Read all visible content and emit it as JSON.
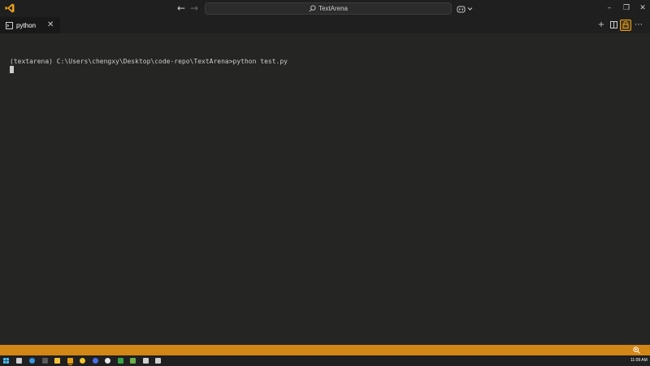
{
  "titlebar": {
    "search_text": "TextArena",
    "back_icon": "arrow-left-icon",
    "forward_icon": "arrow-right-icon",
    "minimize_glyph": "–",
    "restore_glyph": "❐",
    "close_glyph": "✕"
  },
  "tabs": [
    {
      "label": "python",
      "icon": "terminal-icon",
      "active": true
    }
  ],
  "tab_actions": {
    "new_terminal": "+",
    "more": "⋯"
  },
  "terminal": {
    "prompt_line": "(textarena) C:\\Users\\chengxy\\Desktop\\code-repo\\TextArena>python test.py"
  },
  "taskbar": {
    "clock": "11:09 AM"
  },
  "colors": {
    "status_bar": "#d18616",
    "accent": "#e7a117",
    "terminal_bg": "#252523"
  }
}
